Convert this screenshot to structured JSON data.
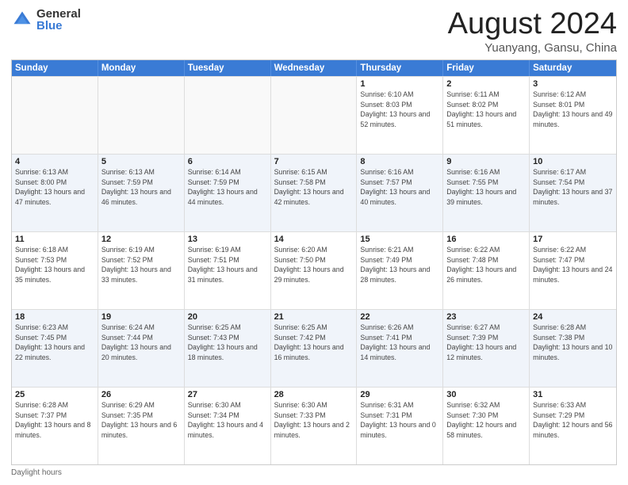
{
  "logo": {
    "general": "General",
    "blue": "Blue"
  },
  "title": "August 2024",
  "location": "Yuanyang, Gansu, China",
  "header_days": [
    "Sunday",
    "Monday",
    "Tuesday",
    "Wednesday",
    "Thursday",
    "Friday",
    "Saturday"
  ],
  "weeks": [
    [
      {
        "day": "",
        "sunrise": "",
        "sunset": "",
        "daylight": "",
        "empty": true
      },
      {
        "day": "",
        "sunrise": "",
        "sunset": "",
        "daylight": "",
        "empty": true
      },
      {
        "day": "",
        "sunrise": "",
        "sunset": "",
        "daylight": "",
        "empty": true
      },
      {
        "day": "",
        "sunrise": "",
        "sunset": "",
        "daylight": "",
        "empty": true
      },
      {
        "day": "1",
        "sunrise": "Sunrise: 6:10 AM",
        "sunset": "Sunset: 8:03 PM",
        "daylight": "Daylight: 13 hours and 52 minutes."
      },
      {
        "day": "2",
        "sunrise": "Sunrise: 6:11 AM",
        "sunset": "Sunset: 8:02 PM",
        "daylight": "Daylight: 13 hours and 51 minutes."
      },
      {
        "day": "3",
        "sunrise": "Sunrise: 6:12 AM",
        "sunset": "Sunset: 8:01 PM",
        "daylight": "Daylight: 13 hours and 49 minutes."
      }
    ],
    [
      {
        "day": "4",
        "sunrise": "Sunrise: 6:13 AM",
        "sunset": "Sunset: 8:00 PM",
        "daylight": "Daylight: 13 hours and 47 minutes."
      },
      {
        "day": "5",
        "sunrise": "Sunrise: 6:13 AM",
        "sunset": "Sunset: 7:59 PM",
        "daylight": "Daylight: 13 hours and 46 minutes."
      },
      {
        "day": "6",
        "sunrise": "Sunrise: 6:14 AM",
        "sunset": "Sunset: 7:59 PM",
        "daylight": "Daylight: 13 hours and 44 minutes."
      },
      {
        "day": "7",
        "sunrise": "Sunrise: 6:15 AM",
        "sunset": "Sunset: 7:58 PM",
        "daylight": "Daylight: 13 hours and 42 minutes."
      },
      {
        "day": "8",
        "sunrise": "Sunrise: 6:16 AM",
        "sunset": "Sunset: 7:57 PM",
        "daylight": "Daylight: 13 hours and 40 minutes."
      },
      {
        "day": "9",
        "sunrise": "Sunrise: 6:16 AM",
        "sunset": "Sunset: 7:55 PM",
        "daylight": "Daylight: 13 hours and 39 minutes."
      },
      {
        "day": "10",
        "sunrise": "Sunrise: 6:17 AM",
        "sunset": "Sunset: 7:54 PM",
        "daylight": "Daylight: 13 hours and 37 minutes."
      }
    ],
    [
      {
        "day": "11",
        "sunrise": "Sunrise: 6:18 AM",
        "sunset": "Sunset: 7:53 PM",
        "daylight": "Daylight: 13 hours and 35 minutes."
      },
      {
        "day": "12",
        "sunrise": "Sunrise: 6:19 AM",
        "sunset": "Sunset: 7:52 PM",
        "daylight": "Daylight: 13 hours and 33 minutes."
      },
      {
        "day": "13",
        "sunrise": "Sunrise: 6:19 AM",
        "sunset": "Sunset: 7:51 PM",
        "daylight": "Daylight: 13 hours and 31 minutes."
      },
      {
        "day": "14",
        "sunrise": "Sunrise: 6:20 AM",
        "sunset": "Sunset: 7:50 PM",
        "daylight": "Daylight: 13 hours and 29 minutes."
      },
      {
        "day": "15",
        "sunrise": "Sunrise: 6:21 AM",
        "sunset": "Sunset: 7:49 PM",
        "daylight": "Daylight: 13 hours and 28 minutes."
      },
      {
        "day": "16",
        "sunrise": "Sunrise: 6:22 AM",
        "sunset": "Sunset: 7:48 PM",
        "daylight": "Daylight: 13 hours and 26 minutes."
      },
      {
        "day": "17",
        "sunrise": "Sunrise: 6:22 AM",
        "sunset": "Sunset: 7:47 PM",
        "daylight": "Daylight: 13 hours and 24 minutes."
      }
    ],
    [
      {
        "day": "18",
        "sunrise": "Sunrise: 6:23 AM",
        "sunset": "Sunset: 7:45 PM",
        "daylight": "Daylight: 13 hours and 22 minutes."
      },
      {
        "day": "19",
        "sunrise": "Sunrise: 6:24 AM",
        "sunset": "Sunset: 7:44 PM",
        "daylight": "Daylight: 13 hours and 20 minutes."
      },
      {
        "day": "20",
        "sunrise": "Sunrise: 6:25 AM",
        "sunset": "Sunset: 7:43 PM",
        "daylight": "Daylight: 13 hours and 18 minutes."
      },
      {
        "day": "21",
        "sunrise": "Sunrise: 6:25 AM",
        "sunset": "Sunset: 7:42 PM",
        "daylight": "Daylight: 13 hours and 16 minutes."
      },
      {
        "day": "22",
        "sunrise": "Sunrise: 6:26 AM",
        "sunset": "Sunset: 7:41 PM",
        "daylight": "Daylight: 13 hours and 14 minutes."
      },
      {
        "day": "23",
        "sunrise": "Sunrise: 6:27 AM",
        "sunset": "Sunset: 7:39 PM",
        "daylight": "Daylight: 13 hours and 12 minutes."
      },
      {
        "day": "24",
        "sunrise": "Sunrise: 6:28 AM",
        "sunset": "Sunset: 7:38 PM",
        "daylight": "Daylight: 13 hours and 10 minutes."
      }
    ],
    [
      {
        "day": "25",
        "sunrise": "Sunrise: 6:28 AM",
        "sunset": "Sunset: 7:37 PM",
        "daylight": "Daylight: 13 hours and 8 minutes."
      },
      {
        "day": "26",
        "sunrise": "Sunrise: 6:29 AM",
        "sunset": "Sunset: 7:35 PM",
        "daylight": "Daylight: 13 hours and 6 minutes."
      },
      {
        "day": "27",
        "sunrise": "Sunrise: 6:30 AM",
        "sunset": "Sunset: 7:34 PM",
        "daylight": "Daylight: 13 hours and 4 minutes."
      },
      {
        "day": "28",
        "sunrise": "Sunrise: 6:30 AM",
        "sunset": "Sunset: 7:33 PM",
        "daylight": "Daylight: 13 hours and 2 minutes."
      },
      {
        "day": "29",
        "sunrise": "Sunrise: 6:31 AM",
        "sunset": "Sunset: 7:31 PM",
        "daylight": "Daylight: 13 hours and 0 minutes."
      },
      {
        "day": "30",
        "sunrise": "Sunrise: 6:32 AM",
        "sunset": "Sunset: 7:30 PM",
        "daylight": "Daylight: 12 hours and 58 minutes."
      },
      {
        "day": "31",
        "sunrise": "Sunrise: 6:33 AM",
        "sunset": "Sunset: 7:29 PM",
        "daylight": "Daylight: 12 hours and 56 minutes."
      }
    ]
  ],
  "footer": "Daylight hours"
}
